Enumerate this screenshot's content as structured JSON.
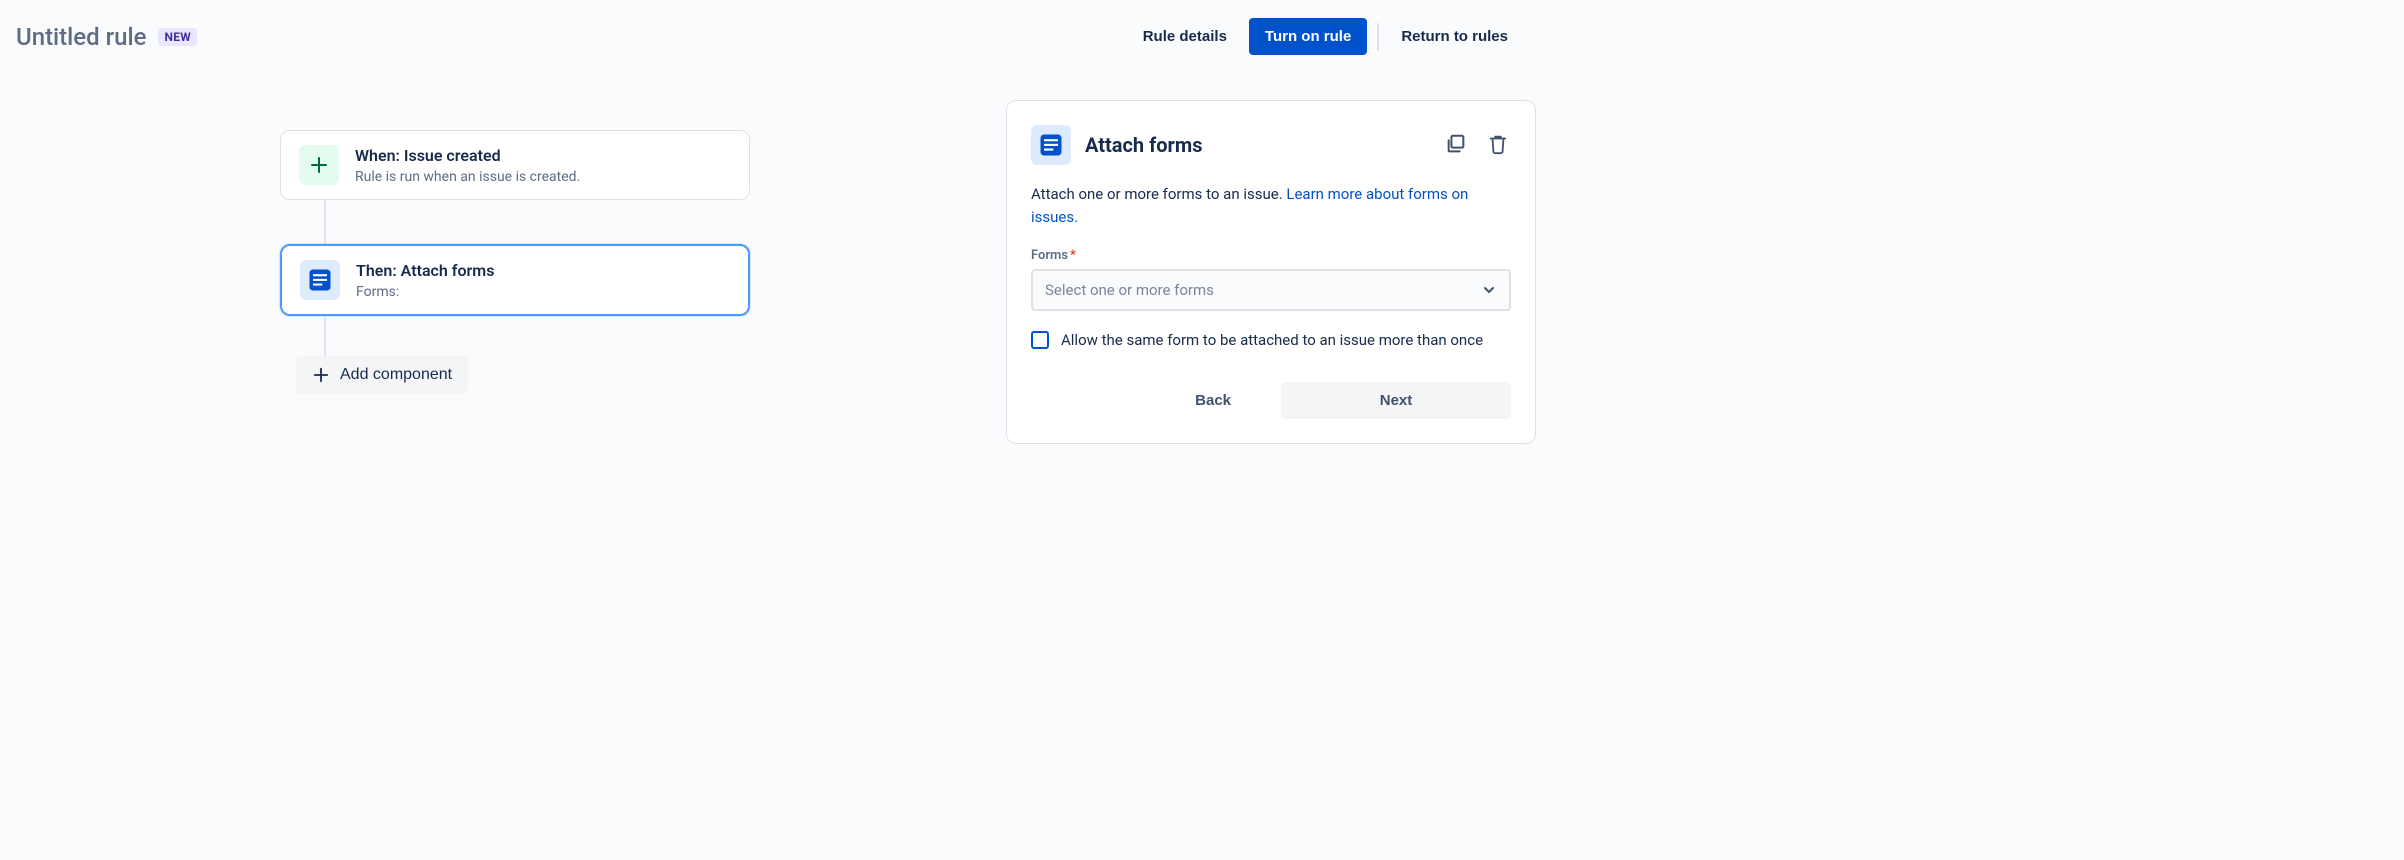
{
  "header": {
    "rule_title": "Untitled rule",
    "badge": "NEW",
    "rule_details": "Rule details",
    "turn_on": "Turn on rule",
    "return": "Return to rules"
  },
  "flow": {
    "trigger": {
      "title": "When: Issue created",
      "subtitle": "Rule is run when an issue is created."
    },
    "action": {
      "title": "Then: Attach forms",
      "subtitle": "Forms:"
    },
    "add_component": "Add component"
  },
  "panel": {
    "title": "Attach forms",
    "description_prefix": "Attach one or more forms to an issue. ",
    "learn_more": "Learn more about forms on issues.",
    "forms_label": "Forms",
    "forms_required": "*",
    "forms_placeholder": "Select one or more forms",
    "checkbox_label": "Allow the same form to be attached to an issue more than once",
    "back": "Back",
    "next": "Next"
  }
}
